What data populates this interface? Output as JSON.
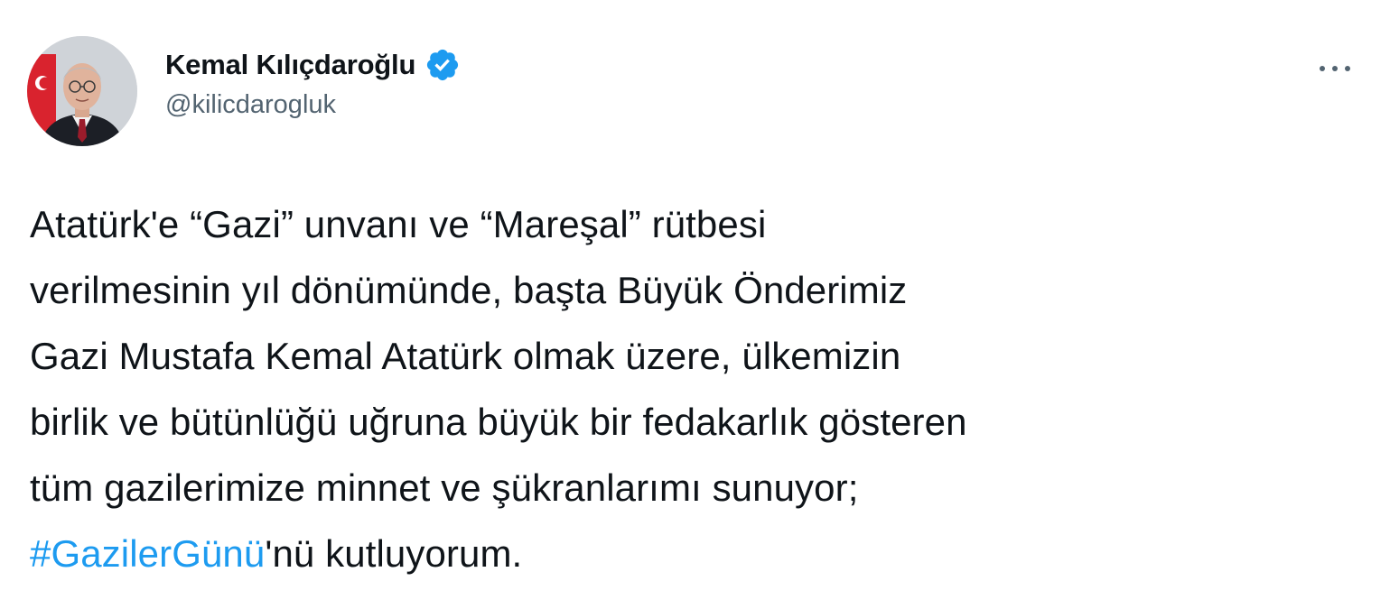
{
  "author": {
    "display_name": "Kemal Kılıçdaroğlu",
    "handle": "@kilicdarogluk",
    "verified": true,
    "avatar_icon": "profile-photo-icon"
  },
  "menu": {
    "icon": "more-options-icon"
  },
  "tweet": {
    "lines": [
      "Atatürk'e “Gazi” unvanı ve “Mareşal” rütbesi",
      "verilmesinin yıl dönümünde, başta Büyük Önderimiz",
      "Gazi Mustafa Kemal Atatürk olmak üzere, ülkemizin",
      "birlik ve bütünlüğü uğruna büyük bir fedakarlık gösteren",
      "tüm gazilerimize minnet ve şükranlarımı sunuyor;"
    ],
    "hashtag": "#GazilerGünü",
    "last_line_suffix": "'nü kutluyorum."
  },
  "colors": {
    "text": "#0f1419",
    "secondary": "#536471",
    "accent": "#1d9bf0"
  }
}
